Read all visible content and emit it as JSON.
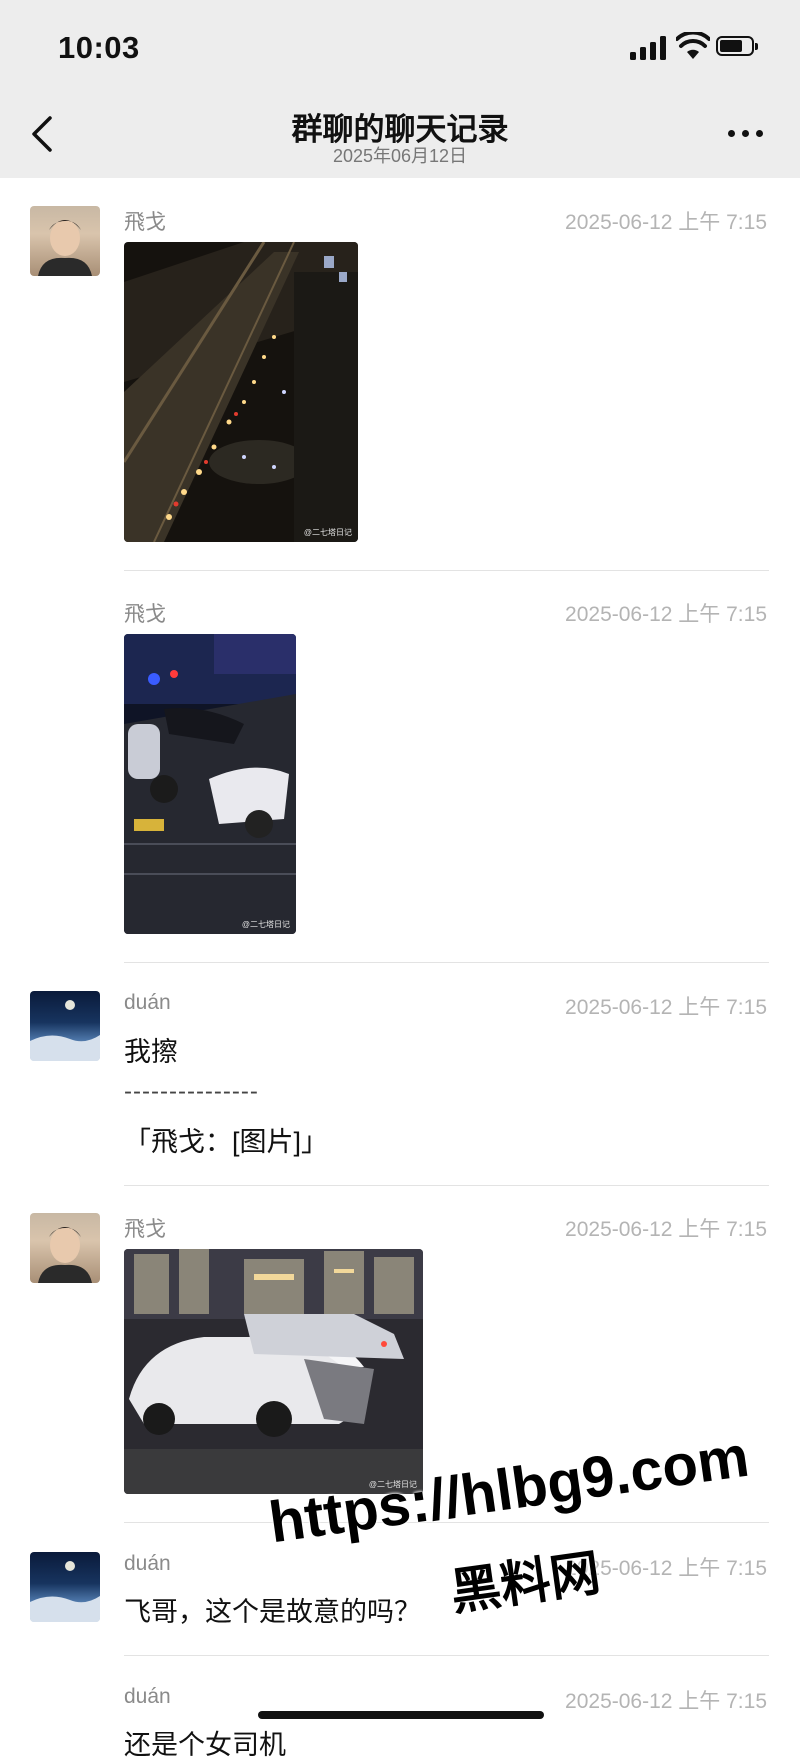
{
  "status_bar": {
    "time": "10:03"
  },
  "header": {
    "title": "群聊的聊天记录",
    "subtitle": "2025年06月12日"
  },
  "messages": [
    {
      "sender": "飛戈",
      "time": "2025-06-12 上午 7:15",
      "image_watermark": "@二七塔日记"
    },
    {
      "sender": "飛戈",
      "time": "2025-06-12 上午 7:15",
      "image_watermark": "@二七塔日记"
    },
    {
      "sender": "duán",
      "time": "2025-06-12 上午 7:15",
      "text": "我擦",
      "separator": "---------------",
      "quote": "「飛戈：[图片]」"
    },
    {
      "sender": "飛戈",
      "time": "2025-06-12 上午 7:15",
      "image_watermark": "@二七塔日记"
    },
    {
      "sender": "duán",
      "time": "2025-06-12 上午 7:15",
      "text": "飞哥，这个是故意的吗？"
    },
    {
      "sender": "duán",
      "time": "2025-06-12 上午 7:15",
      "text": "还是个女司机"
    }
  ],
  "overlay_watermark": {
    "url": "https://hlbg9.com",
    "name": "黑料网"
  }
}
